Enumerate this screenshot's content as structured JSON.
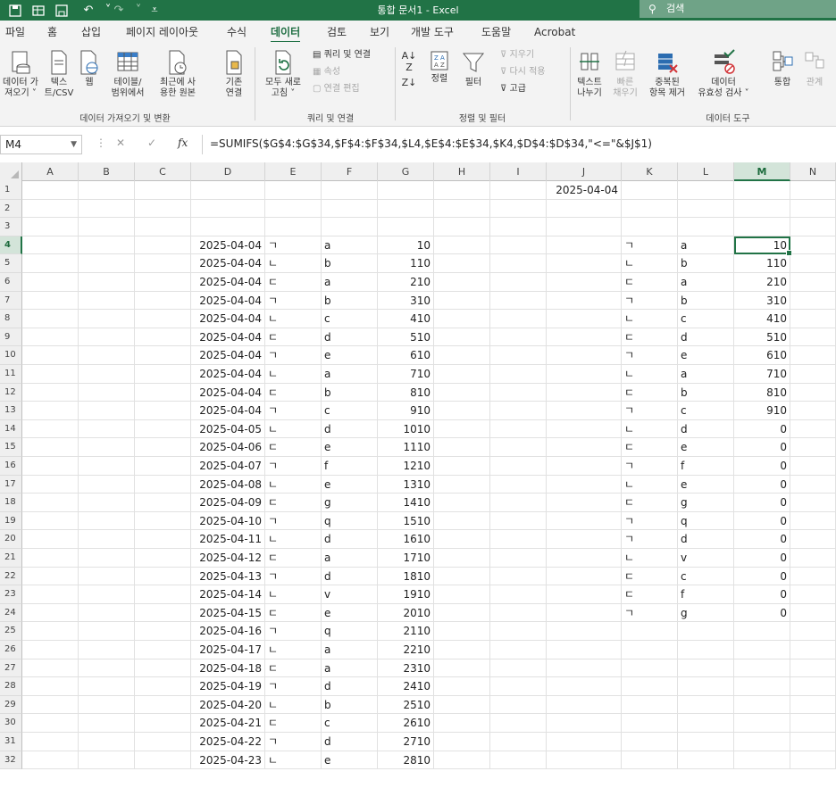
{
  "title_bar": {
    "quick_access": [
      "save-icon-grid",
      "save-icon",
      "undo-icon",
      "redo-icon",
      "customize-icon"
    ],
    "title": "통합 문서1  -  Excel",
    "search_placeholder": "검색",
    "bg_color": "#217346"
  },
  "menu": {
    "tabs": [
      "파일",
      "홈",
      "삽입",
      "페이지 레이아웃",
      "수식",
      "데이터",
      "검토",
      "보기",
      "개발 도구",
      "도움말",
      "Acrobat"
    ],
    "active_tab": "데이터"
  },
  "ribbon": {
    "get_transform": {
      "get_data": "데이터 가\n져오기 ˅",
      "text_csv": "텍스\n트/CSV",
      "web": "웹",
      "from_table": "테이블/\n범위에서",
      "recent_sources": "최근에 사\n용한 원본",
      "existing_connections": "기존\n연결",
      "group_label": "데이터 가져오기 및 변환"
    },
    "queries": {
      "refresh_all": "모두 새로\n고침 ˅",
      "queries_connections": "쿼리 및 연결",
      "properties": "속성",
      "edit_links": "연결 편집",
      "group_label": "쿼리 및 연결"
    },
    "sort_filter": {
      "sort": "정렬",
      "filter": "필터",
      "clear": "지우기",
      "reapply": "다시 적용",
      "advanced": "고급",
      "group_label": "정렬 및 필터"
    },
    "data_tools": {
      "text_to_columns": "텍스트\n나누기",
      "flash_fill": "빠른\n채우기",
      "remove_duplicates": "중복된\n항목 제거",
      "data_validation": "데이터\n유효성 검사 ˅",
      "consolidate": "통합",
      "relationships": "관계",
      "group_label": "데이터 도구"
    }
  },
  "formula_bar": {
    "name_box": "M4",
    "cancel_icon": "✕",
    "enter_icon": "✓",
    "fx_label": "fx",
    "formula": "=SUMIFS($G$4:$G$34,$F$4:$F$34,$L4,$E$4:$E$34,$K4,$D$4:$D$34,\"<=\"&$J$1)"
  },
  "sheet": {
    "columns": [
      "A",
      "B",
      "C",
      "D",
      "E",
      "F",
      "G",
      "H",
      "I",
      "J",
      "K",
      "L",
      "M",
      "N"
    ],
    "selected_column": "M",
    "selected_row": "4",
    "j1": "2025-04-04",
    "row_numbers": [
      "1",
      "2",
      "3",
      "4",
      "5",
      "6",
      "7",
      "8",
      "9",
      "10",
      "11",
      "12",
      "13",
      "14",
      "15",
      "16",
      "17",
      "18",
      "19",
      "20",
      "21",
      "22",
      "23",
      "24",
      "25",
      "26",
      "27",
      "28",
      "29",
      "30",
      "31",
      "32"
    ],
    "data_rows": [
      {
        "d": "2025-04-04",
        "e": "ㄱ",
        "f": "a",
        "g": "10",
        "k": "ㄱ",
        "l": "a",
        "m": "10"
      },
      {
        "d": "2025-04-04",
        "e": "ㄴ",
        "f": "b",
        "g": "110",
        "k": "ㄴ",
        "l": "b",
        "m": "110"
      },
      {
        "d": "2025-04-04",
        "e": "ㄷ",
        "f": "a",
        "g": "210",
        "k": "ㄷ",
        "l": "a",
        "m": "210"
      },
      {
        "d": "2025-04-04",
        "e": "ㄱ",
        "f": "b",
        "g": "310",
        "k": "ㄱ",
        "l": "b",
        "m": "310"
      },
      {
        "d": "2025-04-04",
        "e": "ㄴ",
        "f": "c",
        "g": "410",
        "k": "ㄴ",
        "l": "c",
        "m": "410"
      },
      {
        "d": "2025-04-04",
        "e": "ㄷ",
        "f": "d",
        "g": "510",
        "k": "ㄷ",
        "l": "d",
        "m": "510"
      },
      {
        "d": "2025-04-04",
        "e": "ㄱ",
        "f": "e",
        "g": "610",
        "k": "ㄱ",
        "l": "e",
        "m": "610"
      },
      {
        "d": "2025-04-04",
        "e": "ㄴ",
        "f": "a",
        "g": "710",
        "k": "ㄴ",
        "l": "a",
        "m": "710"
      },
      {
        "d": "2025-04-04",
        "e": "ㄷ",
        "f": "b",
        "g": "810",
        "k": "ㄷ",
        "l": "b",
        "m": "810"
      },
      {
        "d": "2025-04-04",
        "e": "ㄱ",
        "f": "c",
        "g": "910",
        "k": "ㄱ",
        "l": "c",
        "m": "910"
      },
      {
        "d": "2025-04-05",
        "e": "ㄴ",
        "f": "d",
        "g": "1010",
        "k": "ㄴ",
        "l": "d",
        "m": "0"
      },
      {
        "d": "2025-04-06",
        "e": "ㄷ",
        "f": "e",
        "g": "1110",
        "k": "ㄷ",
        "l": "e",
        "m": "0"
      },
      {
        "d": "2025-04-07",
        "e": "ㄱ",
        "f": "f",
        "g": "1210",
        "k": "ㄱ",
        "l": "f",
        "m": "0"
      },
      {
        "d": "2025-04-08",
        "e": "ㄴ",
        "f": "e",
        "g": "1310",
        "k": "ㄴ",
        "l": "e",
        "m": "0"
      },
      {
        "d": "2025-04-09",
        "e": "ㄷ",
        "f": "g",
        "g": "1410",
        "k": "ㄷ",
        "l": "g",
        "m": "0"
      },
      {
        "d": "2025-04-10",
        "e": "ㄱ",
        "f": "q",
        "g": "1510",
        "k": "ㄱ",
        "l": "q",
        "m": "0"
      },
      {
        "d": "2025-04-11",
        "e": "ㄴ",
        "f": "d",
        "g": "1610",
        "k": "ㄱ",
        "l": "d",
        "m": "0"
      },
      {
        "d": "2025-04-12",
        "e": "ㄷ",
        "f": "a",
        "g": "1710",
        "k": "ㄴ",
        "l": "v",
        "m": "0"
      },
      {
        "d": "2025-04-13",
        "e": "ㄱ",
        "f": "d",
        "g": "1810",
        "k": "ㄷ",
        "l": "c",
        "m": "0"
      },
      {
        "d": "2025-04-14",
        "e": "ㄴ",
        "f": "v",
        "g": "1910",
        "k": "ㄷ",
        "l": "f",
        "m": "0"
      },
      {
        "d": "2025-04-15",
        "e": "ㄷ",
        "f": "e",
        "g": "2010",
        "k": "ㄱ",
        "l": "g",
        "m": "0"
      },
      {
        "d": "2025-04-16",
        "e": "ㄱ",
        "f": "q",
        "g": "2110",
        "k": "",
        "l": "",
        "m": ""
      },
      {
        "d": "2025-04-17",
        "e": "ㄴ",
        "f": "a",
        "g": "2210",
        "k": "",
        "l": "",
        "m": ""
      },
      {
        "d": "2025-04-18",
        "e": "ㄷ",
        "f": "a",
        "g": "2310",
        "k": "",
        "l": "",
        "m": ""
      },
      {
        "d": "2025-04-19",
        "e": "ㄱ",
        "f": "d",
        "g": "2410",
        "k": "",
        "l": "",
        "m": ""
      },
      {
        "d": "2025-04-20",
        "e": "ㄴ",
        "f": "b",
        "g": "2510",
        "k": "",
        "l": "",
        "m": ""
      },
      {
        "d": "2025-04-21",
        "e": "ㄷ",
        "f": "c",
        "g": "2610",
        "k": "",
        "l": "",
        "m": ""
      },
      {
        "d": "2025-04-22",
        "e": "ㄱ",
        "f": "d",
        "g": "2710",
        "k": "",
        "l": "",
        "m": ""
      },
      {
        "d": "2025-04-23",
        "e": "ㄴ",
        "f": "e",
        "g": "2810",
        "k": "",
        "l": "",
        "m": ""
      }
    ]
  }
}
